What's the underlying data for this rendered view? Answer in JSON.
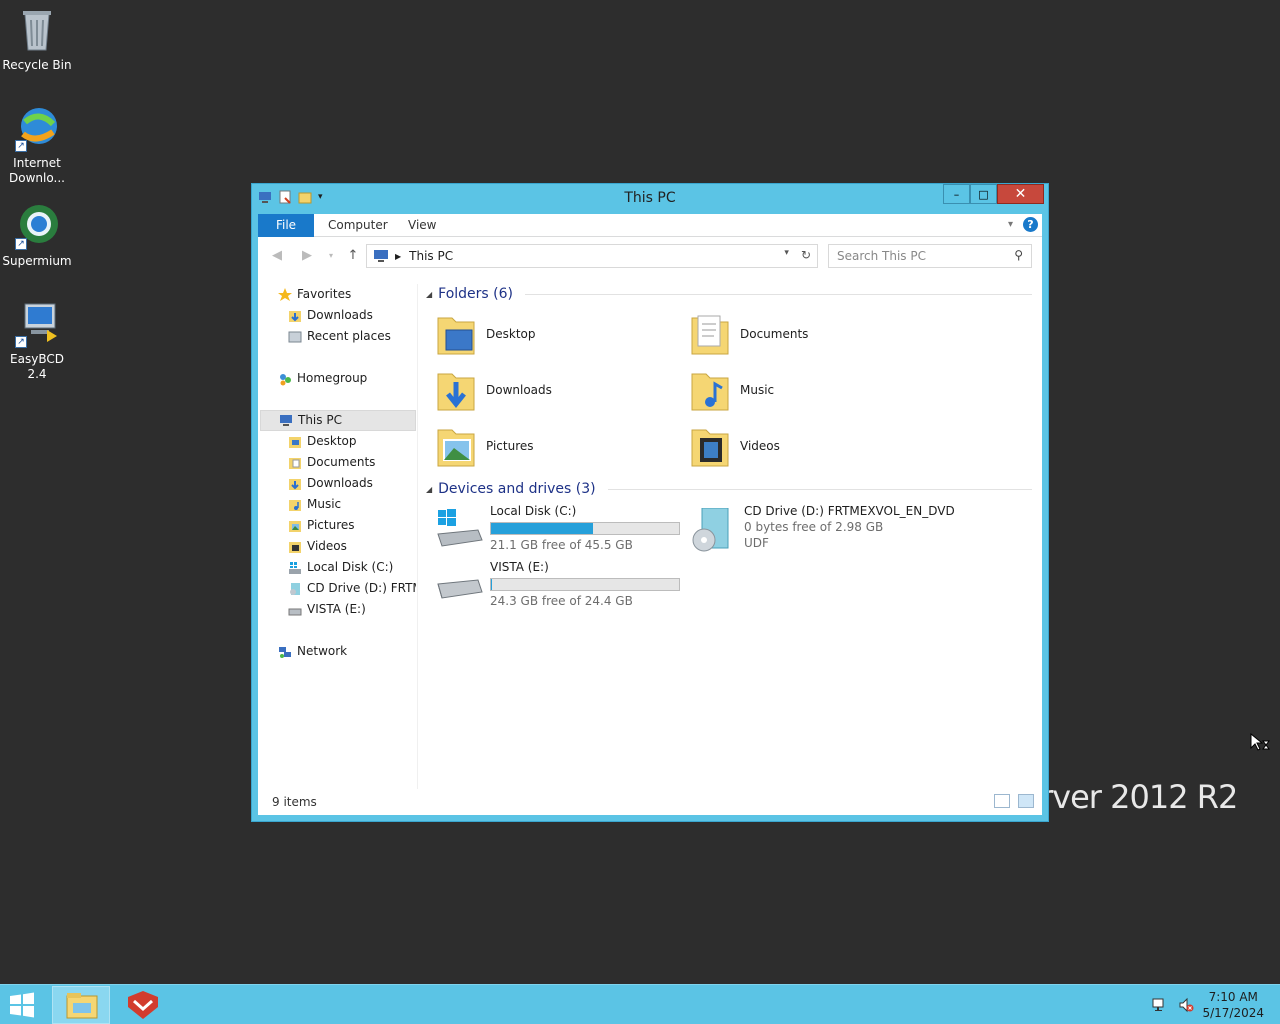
{
  "desktop": {
    "icons": [
      {
        "label": "Recycle Bin",
        "icon": "recycle-bin-icon"
      },
      {
        "label": "Internet Downlo...",
        "icon": "internet-download-manager-icon"
      },
      {
        "label": "Supermium",
        "icon": "supermium-icon"
      },
      {
        "label": "EasyBCD 2.4",
        "icon": "easybcd-icon"
      }
    ],
    "watermark": "rver 2012 R2"
  },
  "window": {
    "title": "This PC",
    "controls": {
      "minimize": "–",
      "maximize": "□",
      "close": "✕"
    },
    "ribbon": {
      "tabs": [
        "File",
        "Computer",
        "View"
      ]
    },
    "address": {
      "path": "This PC"
    },
    "search": {
      "placeholder": "Search This PC"
    },
    "nav_pane": {
      "favorites": {
        "label": "Favorites",
        "items": [
          "Downloads",
          "Recent places"
        ]
      },
      "homegroup": "Homegroup",
      "this_pc": {
        "label": "This PC",
        "items": [
          "Desktop",
          "Documents",
          "Downloads",
          "Music",
          "Pictures",
          "Videos",
          "Local Disk (C:)",
          "CD Drive (D:) FRTME",
          "VISTA (E:)"
        ]
      },
      "network": "Network"
    },
    "folders": {
      "header": "Folders (6)",
      "items": [
        "Desktop",
        "Documents",
        "Downloads",
        "Music",
        "Pictures",
        "Videos"
      ]
    },
    "devices": {
      "header": "Devices and drives (3)",
      "drives": [
        {
          "name": "Local Disk (C:)",
          "free": "21.1 GB free of 45.5 GB",
          "used_fraction": 0.54
        },
        {
          "name": "CD Drive (D:) FRTMEXVOL_EN_DVD",
          "free": "0 bytes free of 2.98 GB",
          "fs": "UDF"
        },
        {
          "name": "VISTA (E:)",
          "free": "24.3 GB free of 24.4 GB",
          "used_fraction": 0.004
        }
      ]
    },
    "status": {
      "count": "9 items"
    }
  },
  "taskbar": {
    "time": "7:10 AM",
    "date": "5/17/2024"
  }
}
